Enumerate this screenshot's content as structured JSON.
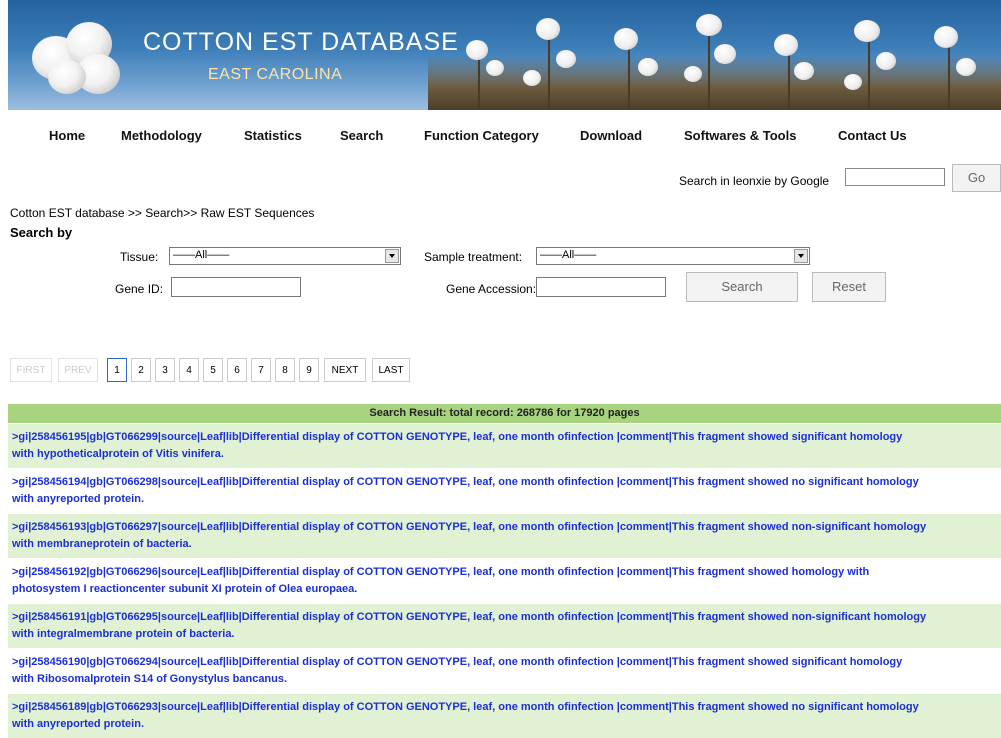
{
  "banner": {
    "title": "COTTON  EST  DATABASE",
    "subtitle": "EAST CAROLINA"
  },
  "nav": {
    "items": [
      "Home",
      "Methodology",
      "Statistics",
      "Search",
      "Function Category",
      "Download",
      "Softwares & Tools",
      "Contact Us"
    ]
  },
  "google_search": {
    "label": "Search in leonxie by Google",
    "value": "",
    "button": "Go"
  },
  "breadcrumb": "Cotton EST database >> Search>> Raw EST Sequences",
  "search_by": "Search by",
  "form": {
    "tissue_label": "Tissue:",
    "tissue_value": "——All——",
    "treatment_label": "Sample treatment:",
    "treatment_value": "——All——",
    "gene_id_label": "Gene ID:",
    "gene_id_value": "",
    "gene_acc_label": "Gene Accession:",
    "gene_acc_value": "",
    "search_button": "Search",
    "reset_button": "Reset"
  },
  "pagination": {
    "first": "FIRST",
    "prev": "PREV",
    "pages": [
      "1",
      "2",
      "3",
      "4",
      "5",
      "6",
      "7",
      "8",
      "9"
    ],
    "current": "1",
    "next": "NEXT",
    "last": "LAST"
  },
  "results": {
    "header": "Search Result: total record: 268786    for 17920 pages",
    "records": [
      {
        "line1": ">gi|258456195|gb|GT066299|source|Leaf|lib|Differential display of COTTON GENOTYPE, leaf, one month ofinfection |comment|This fragment showed significant homology",
        "line2": "with hypotheticalprotein of Vitis vinifera."
      },
      {
        "line1": ">gi|258456194|gb|GT066298|source|Leaf|lib|Differential display of COTTON GENOTYPE, leaf, one month ofinfection |comment|This fragment showed no significant homology",
        "line2": "with anyreported protein."
      },
      {
        "line1": ">gi|258456193|gb|GT066297|source|Leaf|lib|Differential display of COTTON GENOTYPE, leaf, one month ofinfection |comment|This fragment showed non-significant homology",
        "line2": "with membraneprotein of bacteria."
      },
      {
        "line1": ">gi|258456192|gb|GT066296|source|Leaf|lib|Differential display of COTTON GENOTYPE, leaf, one month ofinfection |comment|This fragment showed homology with",
        "line2": "photosystem I reactioncenter subunit XI protein of Olea europaea."
      },
      {
        "line1": ">gi|258456191|gb|GT066295|source|Leaf|lib|Differential display of COTTON GENOTYPE, leaf, one month ofinfection |comment|This fragment showed non-significant homology",
        "line2": "with integralmembrane protein of bacteria."
      },
      {
        "line1": ">gi|258456190|gb|GT066294|source|Leaf|lib|Differential display of COTTON GENOTYPE, leaf, one month ofinfection |comment|This fragment showed significant homology",
        "line2": "with Ribosomalprotein S14 of Gonystylus bancanus."
      },
      {
        "line1": ">gi|258456189|gb|GT066293|source|Leaf|lib|Differential display of COTTON GENOTYPE, leaf, one month ofinfection |comment|This fragment showed no significant homology",
        "line2": "with anyreported protein."
      }
    ]
  }
}
